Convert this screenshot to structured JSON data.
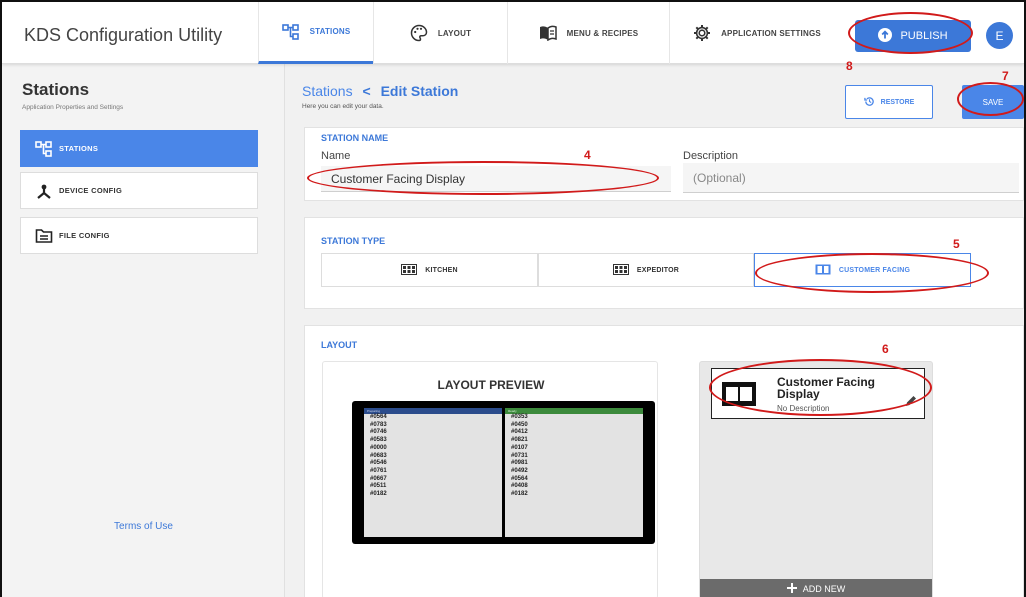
{
  "app_title": "KDS Configuration Utility",
  "nav": {
    "tabs": [
      {
        "label": "STATIONS",
        "icon": "stations-icon"
      },
      {
        "label": "LAYOUT",
        "icon": "palette-icon"
      },
      {
        "label": "MENU & RECIPES",
        "icon": "book-icon"
      },
      {
        "label": "APPLICATION SETTINGS",
        "icon": "gear-icon"
      }
    ],
    "publish_label": "PUBLISH",
    "avatar_initial": "E"
  },
  "sidebar": {
    "title": "Stations",
    "subtitle": "Application Properties and Settings",
    "items": [
      {
        "label": "STATIONS",
        "icon": "stations-icon"
      },
      {
        "label": "DEVICE CONFIG",
        "icon": "device-hub-icon"
      },
      {
        "label": "FILE CONFIG",
        "icon": "file-icon"
      }
    ],
    "terms_label": "Terms of Use"
  },
  "main": {
    "breadcrumb_root": "Stations",
    "breadcrumb_sep": "<",
    "breadcrumb_current": "Edit Station",
    "subtitle": "Here you can edit your data.",
    "restore_label": "RESTORE",
    "save_label": "SAVE"
  },
  "station_name": {
    "heading": "STATION NAME",
    "name_label": "Name",
    "name_value": "Customer Facing Display",
    "description_label": "Description",
    "description_placeholder": "(Optional)"
  },
  "station_type": {
    "heading": "STATION TYPE",
    "options": [
      "KITCHEN",
      "EXPEDITOR",
      "CUSTOMER FACING"
    ],
    "selected": "CUSTOMER FACING"
  },
  "layout": {
    "heading": "LAYOUT",
    "preview_title": "LAYOUT PREVIEW",
    "preview_left_header": "Preparing",
    "preview_right_header": "Ready",
    "preview_left_orders": [
      "#0564",
      "#0783",
      "#0746",
      "#0583",
      "#0000",
      "#0683",
      "#0546",
      "#0761",
      "#0667",
      "#0511",
      "#0182"
    ],
    "preview_right_orders": [
      "#0353",
      "#0450",
      "#0412",
      "#0821",
      "#0107",
      "#0731",
      "#0981",
      "#0492",
      "#0564",
      "#0408",
      "#0182"
    ],
    "display_name": "Customer Facing Display",
    "display_description": "No Description",
    "add_new_label": "ADD NEW"
  },
  "annotations": [
    "4",
    "5",
    "6",
    "7",
    "8"
  ],
  "colors": {
    "accent": "#3c78d8",
    "annotation": "#d11a1a"
  }
}
